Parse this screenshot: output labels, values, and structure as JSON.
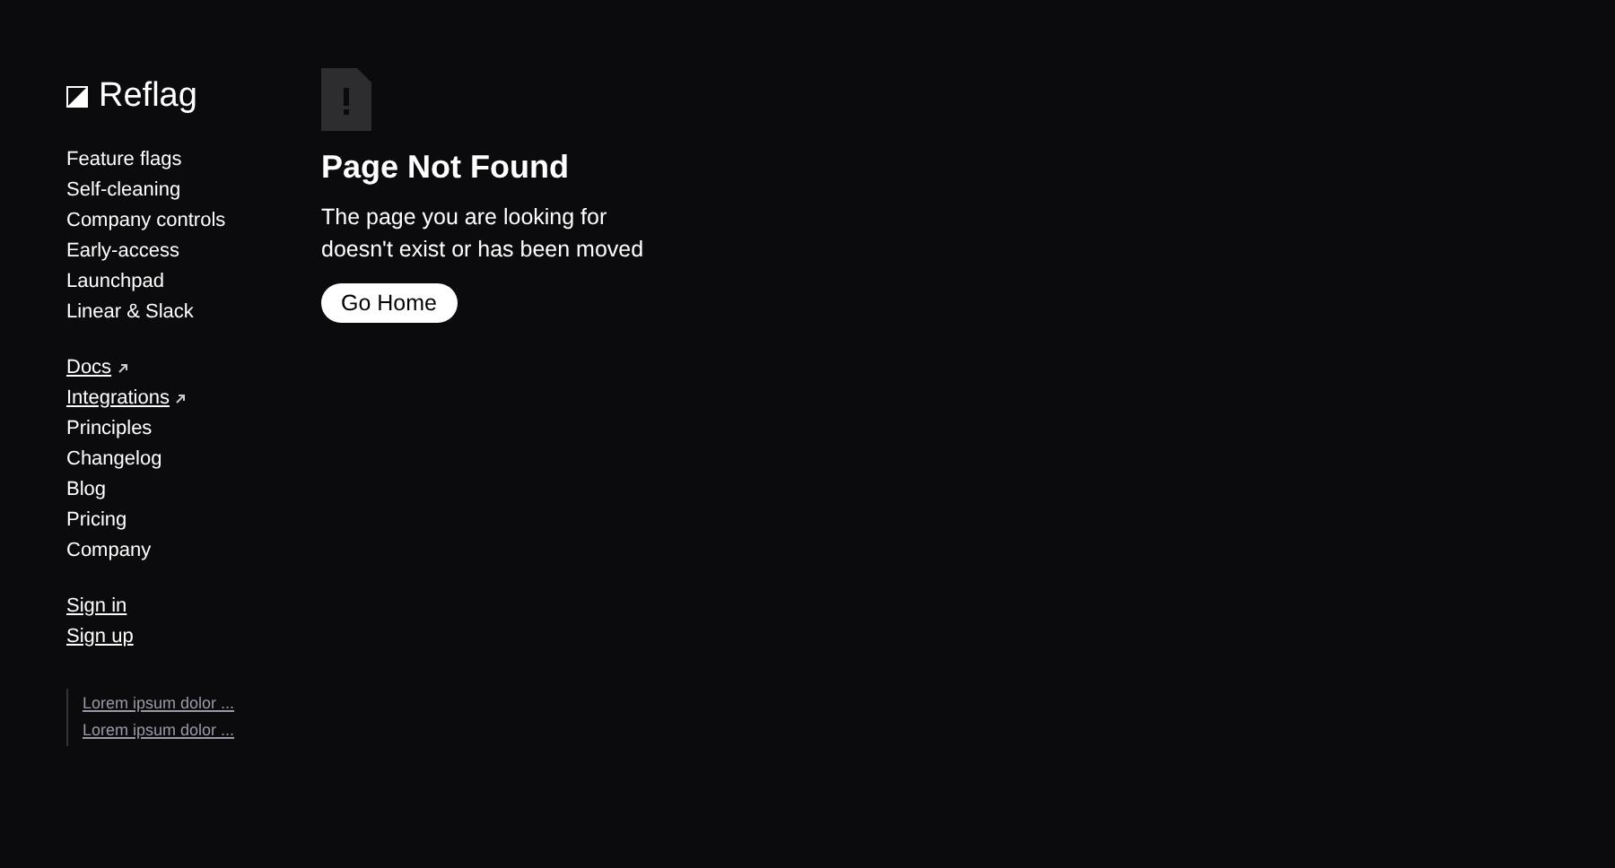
{
  "brand": {
    "name": "Reflag"
  },
  "nav_groups": [
    {
      "items": [
        {
          "label": "Feature flags",
          "underlined": false,
          "external": false
        },
        {
          "label": "Self-cleaning",
          "underlined": false,
          "external": false
        },
        {
          "label": "Company controls",
          "underlined": false,
          "external": false
        },
        {
          "label": "Early-access",
          "underlined": false,
          "external": false
        },
        {
          "label": "Launchpad",
          "underlined": false,
          "external": false
        },
        {
          "label": "Linear & Slack",
          "underlined": false,
          "external": false
        }
      ]
    },
    {
      "items": [
        {
          "label": "Docs",
          "underlined": true,
          "external": true
        },
        {
          "label": "Integrations",
          "underlined": true,
          "external": true
        },
        {
          "label": "Principles",
          "underlined": false,
          "external": false
        },
        {
          "label": "Changelog",
          "underlined": false,
          "external": false
        },
        {
          "label": "Blog",
          "underlined": false,
          "external": false
        },
        {
          "label": "Pricing",
          "underlined": false,
          "external": false
        },
        {
          "label": "Company",
          "underlined": false,
          "external": false
        }
      ]
    },
    {
      "items": [
        {
          "label": "Sign in",
          "underlined": true,
          "external": false
        },
        {
          "label": "Sign up",
          "underlined": true,
          "external": false
        }
      ]
    }
  ],
  "recent_links": [
    "Lorem ipsum dolor ...",
    "Lorem ipsum dolor ..."
  ],
  "error": {
    "title": "Page Not Found",
    "message": "The page you are looking for doesn't exist or has been moved",
    "button": "Go Home"
  }
}
